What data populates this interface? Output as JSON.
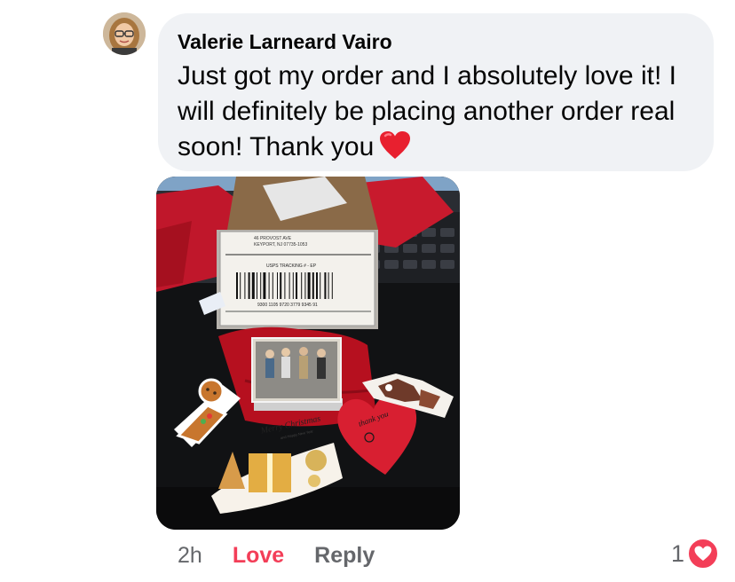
{
  "comment": {
    "author": "Valerie Larneard Vairo",
    "text": "Just got my order and I absolutely love it! I will definitely be placing another order real soon! Thank you",
    "emoji": "red-heart-icon",
    "avatar_icon": "profile-photo"
  },
  "photo": {
    "label_lines": [
      "46 PROVOST AVE",
      "KEYPORT, NJ 07735-1053"
    ],
    "tracking_label": "USPS TRACKING # - EP",
    "tracking_number": "9300 1105 9720 3779 9345 91",
    "card_text": "Merry Christmas",
    "card_subtext": "and Happy New Year",
    "heart_text": "thank you"
  },
  "actions": {
    "time": "2h",
    "love_label": "Love",
    "reply_label": "Reply"
  },
  "reactions": {
    "count": "1",
    "icon": "love-reaction-icon"
  },
  "colors": {
    "bubble_bg": "#f0f2f5",
    "love_color": "#f33e58",
    "meta_text": "#65676b"
  }
}
